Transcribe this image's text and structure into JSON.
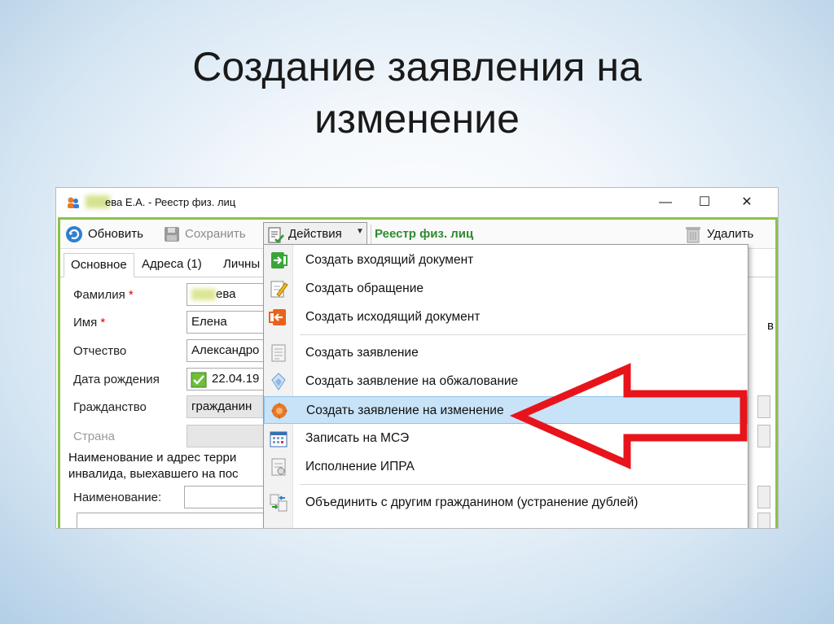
{
  "slide": {
    "title_line1": "Создание заявления на",
    "title_line2": "изменение"
  },
  "window": {
    "title": "ева Е.А. - Реестр физ. лиц",
    "minimize": "—",
    "maximize": "☐",
    "close": "✕"
  },
  "toolbar": {
    "refresh": "Обновить",
    "save": "Сохранить",
    "actions": "Действия",
    "registry": "Реестр физ. лиц",
    "delete": "Удалить"
  },
  "tabs": [
    "Основное",
    "Адреса (1)",
    "Личны"
  ],
  "form": {
    "surname_label": "Фамилия",
    "surname_value": "ева",
    "name_label": "Имя",
    "name_value": "Елена",
    "patronymic_label": "Отчество",
    "patronymic_value": "Александро",
    "birthdate_label": "Дата рождения",
    "birthdate_value": "22.04.19",
    "citizenship_label": "Гражданство",
    "citizenship_value": "гражданин",
    "country_label": "Страна",
    "territory_text_line1": "Наименование и адрес терри",
    "territory_text_line2": "инвалида, выехавшего на пос",
    "org_name_label": "Наименование:",
    "required_mark": "*",
    "edge_letter": "в"
  },
  "menu": {
    "items": [
      {
        "label": "Создать входящий документ",
        "icon": "incoming-doc-icon"
      },
      {
        "label": "Создать обращение",
        "icon": "pencil-doc-icon"
      },
      {
        "label": "Создать исходящий документ",
        "icon": "outgoing-doc-icon"
      },
      {
        "label": "Создать заявление",
        "icon": "document-icon"
      },
      {
        "label": "Создать заявление на обжалование",
        "icon": "appeal-doc-icon"
      },
      {
        "label": "Создать заявление на изменение",
        "icon": "change-request-icon"
      },
      {
        "label": "Записать на МСЭ",
        "icon": "calendar-icon"
      },
      {
        "label": "Исполнение ИПРА",
        "icon": "execution-doc-icon"
      },
      {
        "label": "Объединить с другим гражданином (устранение дублей)",
        "icon": "merge-icon"
      }
    ],
    "highlighted_index": 5
  },
  "colors": {
    "frame_green": "#8bc34a",
    "registry_green": "#2e8b2e",
    "highlight": "#c8e3f8",
    "arrow_red": "#e8141b"
  }
}
